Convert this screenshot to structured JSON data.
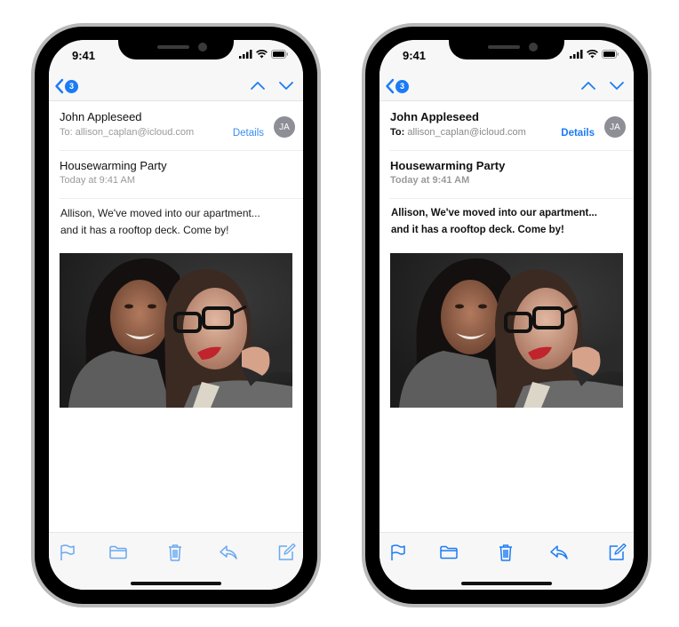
{
  "phones": [
    {
      "variant": "regular-text",
      "status_bar": {
        "time": "9:41"
      },
      "nav": {
        "back_badge_count": "3",
        "prev_icon": "chevron-up-icon",
        "next_icon": "chevron-down-icon"
      },
      "message": {
        "sender": "John Appleseed",
        "to_label": "To:",
        "to_address": "allison_caplan@icloud.com",
        "details_label": "Details",
        "avatar_initials": "JA",
        "subject": "Housewarming Party",
        "date": "Today at 9:41 AM",
        "body_line_1": "Allison, We've moved into our apartment...",
        "body_line_2": "and it has a rooftop deck. Come by!",
        "photo_description": "Two smiling women embracing"
      },
      "toolbar": [
        "flag-icon",
        "folder-icon",
        "trash-icon",
        "reply-icon",
        "compose-icon"
      ]
    },
    {
      "variant": "bold-text",
      "status_bar": {
        "time": "9:41"
      },
      "nav": {
        "back_badge_count": "3",
        "prev_icon": "chevron-up-icon",
        "next_icon": "chevron-down-icon"
      },
      "message": {
        "sender": "John Appleseed",
        "to_label": "To:",
        "to_address": "allison_caplan@icloud.com",
        "details_label": "Details",
        "avatar_initials": "JA",
        "subject": "Housewarming Party",
        "date": "Today at 9:41 AM",
        "body_line_1": "Allison, We've moved into our apartment...",
        "body_line_2": "and it has a rooftop deck. Come by!",
        "photo_description": "Two smiling women embracing"
      },
      "toolbar": [
        "flag-icon",
        "folder-icon",
        "trash-icon",
        "reply-icon",
        "compose-icon"
      ]
    }
  ],
  "colors": {
    "accent": "#1a7cf5",
    "accent_light": "#3a8ef0",
    "secondary_text": "#9a9a9a",
    "avatar_bg": "#8e8f96",
    "bar_bg": "#f7f7f7"
  }
}
